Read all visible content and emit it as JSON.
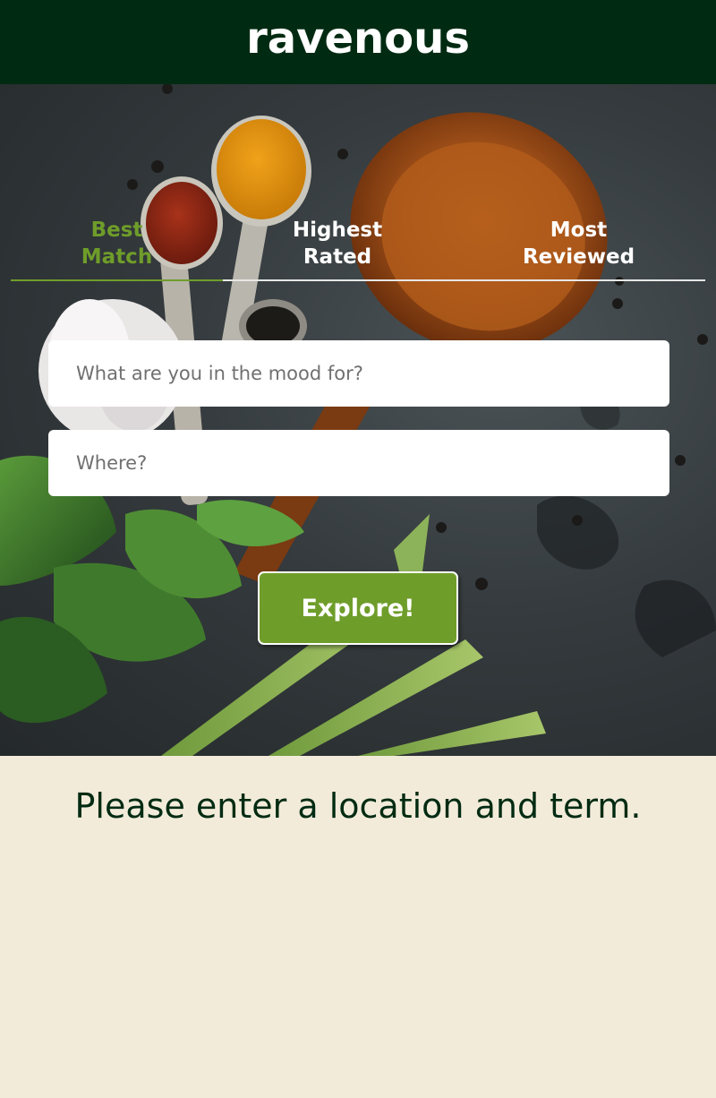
{
  "header": {
    "logo": "ravenous"
  },
  "tabs": [
    {
      "label": "Best\nMatch",
      "active": true
    },
    {
      "label": "Highest\nRated",
      "active": false
    },
    {
      "label": "Most\nReviewed",
      "active": false
    }
  ],
  "search": {
    "term_placeholder": "What are you in the mood for?",
    "term_value": "",
    "location_placeholder": "Where?",
    "location_value": ""
  },
  "explore_label": "Explore!",
  "message": "Please enter a location and term.",
  "colors": {
    "header": "#002b12",
    "accent": "#6f9d2a",
    "background": "#f3ebda",
    "text_dark": "#002b12"
  }
}
